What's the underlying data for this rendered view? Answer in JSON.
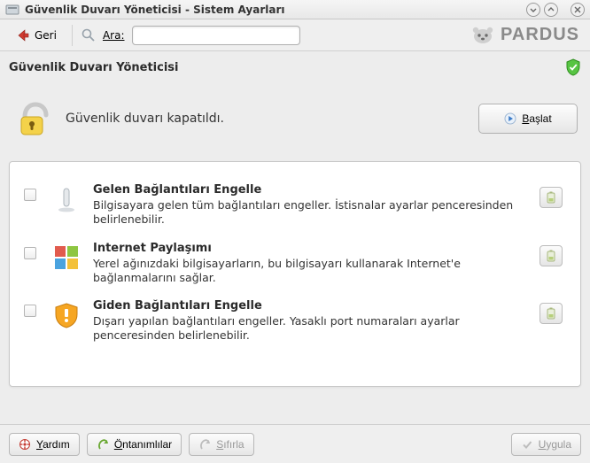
{
  "window": {
    "title": "Güvenlik Duvarı Yöneticisi - Sistem Ayarları"
  },
  "toolbar": {
    "back_label": "Geri",
    "search_label": "Ara:",
    "search_value": "",
    "brand": "pardus"
  },
  "module": {
    "title": "Güvenlik Duvarı Yöneticisi"
  },
  "status": {
    "text": "Güvenlik duvarı kapatıldı.",
    "start_prefix": "B",
    "start_suffix": "aşlat"
  },
  "items": [
    {
      "title": "Gelen Bağlantıları Engelle",
      "desc": "Bilgisayara gelen tüm bağlantıları engeller. İstisnalar ayarlar penceresinden belirlenebilir."
    },
    {
      "title": "Internet Paylaşımı",
      "desc": "Yerel ağınızdaki bilgisayarların, bu bilgisayarı kullanarak Internet'e bağlanmalarını sağlar."
    },
    {
      "title": "Giden Bağlantıları Engelle",
      "desc": "Dışarı yapılan bağlantıları engeller. Yasaklı port numaraları ayarlar penceresinden belirlenebilir."
    }
  ],
  "footer": {
    "help_prefix": "Y",
    "help_suffix": "ardım",
    "defaults_prefix": "Ö",
    "defaults_suffix": "ntanımlılar",
    "reset_prefix": "S",
    "reset_suffix": "ıfırla",
    "apply_prefix": "U",
    "apply_suffix": "ygula"
  },
  "colors": {
    "accent_red": "#c83028",
    "shield_green": "#4fbf3a"
  }
}
